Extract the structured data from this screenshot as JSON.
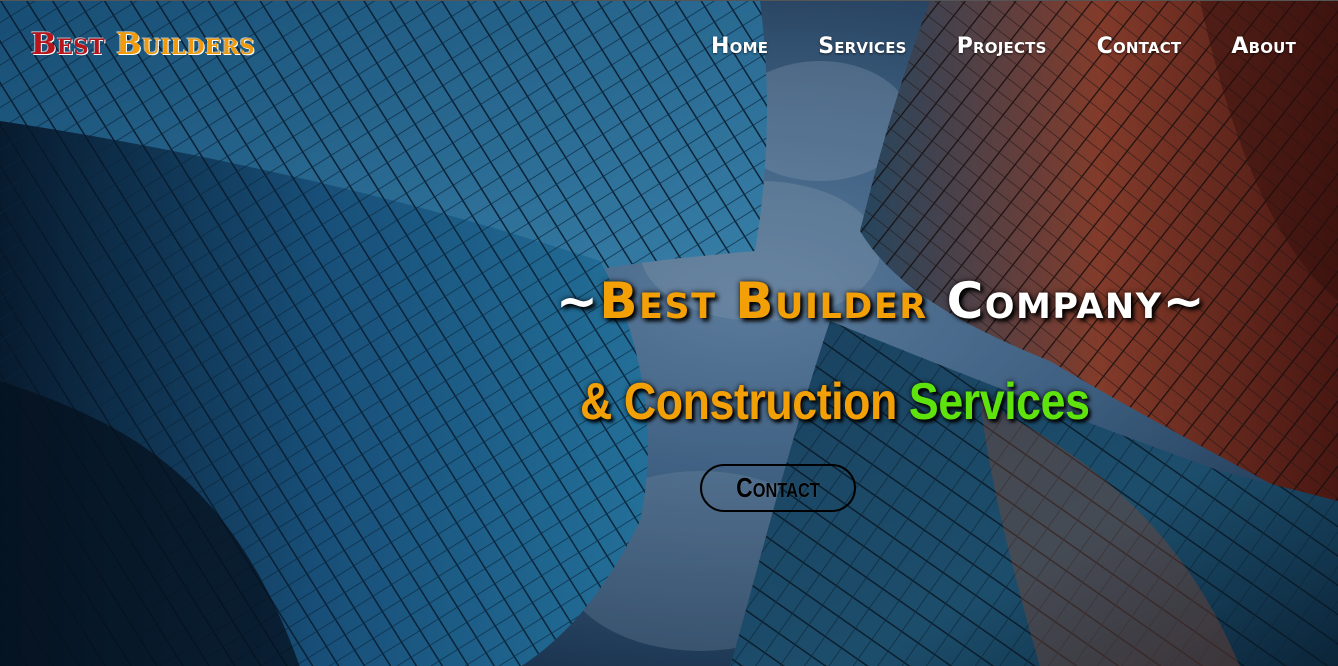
{
  "brand": {
    "word1": "Best",
    "word2": "Builders",
    "color1": "#b8141b",
    "color2": "#f29a0a"
  },
  "nav": {
    "items": [
      {
        "label": "Home"
      },
      {
        "label": "Services"
      },
      {
        "label": "Projects"
      },
      {
        "label": "Contact"
      },
      {
        "label": "About"
      }
    ]
  },
  "hero": {
    "background": "skyscrapers-upward-view",
    "headline_1": {
      "tilde_left": "~",
      "part_orange": "Best Builder",
      "part_white": "Company",
      "tilde_right": "~"
    },
    "headline_2": {
      "part_orange": "& Construction",
      "part_green": "Services"
    },
    "cta_label": "Contact",
    "accent_orange": "#f3a007",
    "accent_green": "#5fe30c"
  }
}
